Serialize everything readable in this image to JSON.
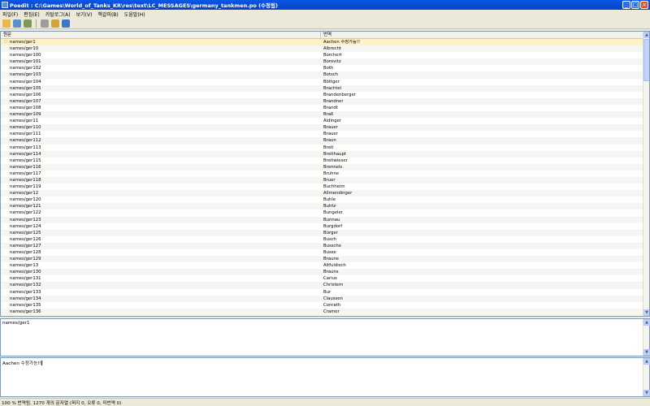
{
  "window": {
    "title": "Poedit : C:\\Games\\World_of_Tanks_KR\\res\\text\\LC_MESSAGES\\germany_tankmen.po (수정됨)",
    "controls": [
      "_",
      "□",
      "×"
    ]
  },
  "menu": [
    "파일(F)",
    "편집(E)",
    "카탈로그(A)",
    "보기(V)",
    "책갈피(B)",
    "도움말(H)"
  ],
  "toolbar": {
    "buttons": [
      {
        "icon": "open-folder-icon",
        "color": "#e8b84a"
      },
      {
        "icon": "save-icon",
        "color": "#5b8fd0"
      },
      {
        "icon": "update-icon",
        "color": "#7a9a5a"
      },
      {
        "icon": "validate-icon",
        "color": "#9c9c9c"
      },
      {
        "icon": "comment-icon",
        "color": "#d4a23a"
      },
      {
        "icon": "fullscreen-icon",
        "color": "#3a78c8"
      }
    ]
  },
  "list": {
    "columns": {
      "source": "원문",
      "translation": "번역"
    },
    "rows": [
      {
        "source": "names/ger1",
        "translation": "Aachen 수정가능!!"
      },
      {
        "source": "names/ger10",
        "translation": "Albrecht"
      },
      {
        "source": "names/ger100",
        "translation": "Borchert"
      },
      {
        "source": "names/ger101",
        "translation": "Borovitz"
      },
      {
        "source": "names/ger102",
        "translation": "Both"
      },
      {
        "source": "names/ger103",
        "translation": "Botsch"
      },
      {
        "source": "names/ger104",
        "translation": "Böttger"
      },
      {
        "source": "names/ger105",
        "translation": "Brachtel"
      },
      {
        "source": "names/ger106",
        "translation": "Brandenberger"
      },
      {
        "source": "names/ger107",
        "translation": "Brandner"
      },
      {
        "source": "names/ger108",
        "translation": "Brandt"
      },
      {
        "source": "names/ger109",
        "translation": "Braß"
      },
      {
        "source": "names/ger11",
        "translation": "Aldinger"
      },
      {
        "source": "names/ger110",
        "translation": "Brauer"
      },
      {
        "source": "names/ger111",
        "translation": "Brauer"
      },
      {
        "source": "names/ger112",
        "translation": "Braun"
      },
      {
        "source": "names/ger113",
        "translation": "Breit"
      },
      {
        "source": "names/ger114",
        "translation": "Breithaupt"
      },
      {
        "source": "names/ger115",
        "translation": "Breitwieser"
      },
      {
        "source": "names/ger116",
        "translation": "Brennels"
      },
      {
        "source": "names/ger117",
        "translation": "Bruhne"
      },
      {
        "source": "names/ger118",
        "translation": "Bruer"
      },
      {
        "source": "names/ger119",
        "translation": "Buchheim"
      },
      {
        "source": "names/ger12",
        "translation": "Allmendinger"
      },
      {
        "source": "names/ger120",
        "translation": "Buhle"
      },
      {
        "source": "names/ger121",
        "translation": "Buhtz"
      },
      {
        "source": "names/ger122",
        "translation": "Bungeler"
      },
      {
        "source": "names/ger123",
        "translation": "Bunnau"
      },
      {
        "source": "names/ger124",
        "translation": "Burgdorf"
      },
      {
        "source": "names/ger125",
        "translation": "Bürger"
      },
      {
        "source": "names/ger126",
        "translation": "Busch"
      },
      {
        "source": "names/ger127",
        "translation": "Bussche"
      },
      {
        "source": "names/ger128",
        "translation": "Busse"
      },
      {
        "source": "names/ger129",
        "translation": "Braune"
      },
      {
        "source": "names/ger13",
        "translation": "Altfuldisch"
      },
      {
        "source": "names/ger130",
        "translation": "Brauns"
      },
      {
        "source": "names/ger131",
        "translation": "Carius"
      },
      {
        "source": "names/ger132",
        "translation": "Christern"
      },
      {
        "source": "names/ger133",
        "translation": "Bur"
      },
      {
        "source": "names/ger134",
        "translation": "Claussen"
      },
      {
        "source": "names/ger135",
        "translation": "Conrath"
      },
      {
        "source": "names/ger136",
        "translation": "Cramer"
      }
    ],
    "selected_index": 0,
    "selected_marker": "○"
  },
  "editor": {
    "source_text": "names/ger1",
    "translation_text": "Aachen 수정가능!!"
  },
  "status": {
    "text": "100 % 번역됨, 1270 개의 문자열 (퍼지 0, 오류 0, 미번역 0)"
  },
  "scroll": {
    "up": "▲",
    "down": "▼"
  }
}
